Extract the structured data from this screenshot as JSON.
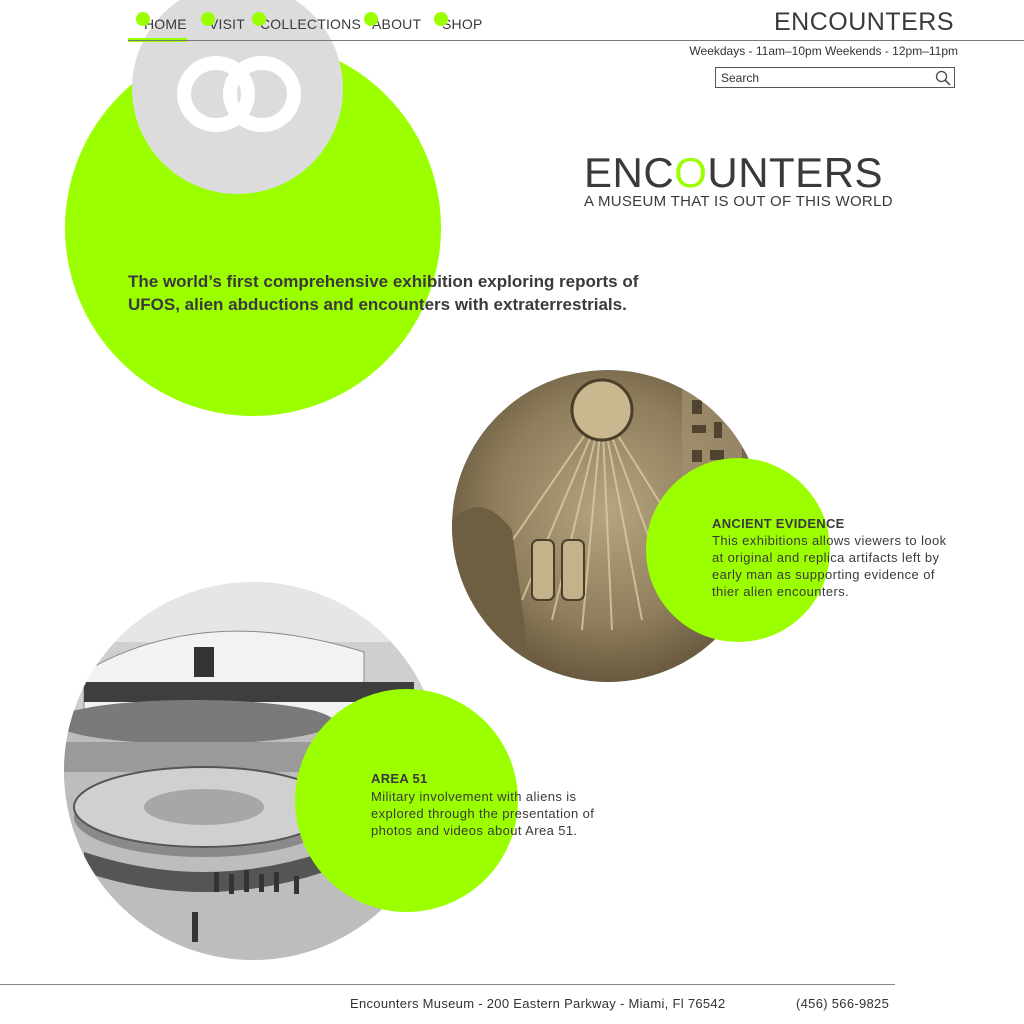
{
  "nav": {
    "items": [
      {
        "label": "HOME"
      },
      {
        "label": "VISIT"
      },
      {
        "label": "COLLECTIONS"
      },
      {
        "label": "ABOUT"
      },
      {
        "label": "SHOP"
      }
    ],
    "active": "HOME"
  },
  "header": {
    "brand": "ENCOUNTERS",
    "hours": "Weekdays - 11am–10pm Weekends - 12pm–11pm"
  },
  "search": {
    "placeholder": "Search",
    "icon": "search-icon"
  },
  "hero": {
    "title_part1": "ENC",
    "title_accent": "O",
    "title_part2": "UNTERS",
    "tagline": "A MUSEUM THAT IS OUT OF THIS WORLD",
    "intro": "The world’s first comprehensive exhibition exploring reports of UFOS, alien abductions and encounters with extraterrestrials."
  },
  "features": {
    "ancient": {
      "title": "ANCIENT EVIDENCE",
      "text": "This exhibitions allows viewers to look at original and replica artifacts left by early man as supporting evidence of thier alien encounters."
    },
    "area51": {
      "title": "AREA 51",
      "text": "Military involvement with aliens is explored through the presentation of photos and videos about Area 51."
    }
  },
  "footer": {
    "address": "Encounters Museum - 200 Eastern Parkway - Miami, Fl 76542",
    "phone": "(456) 566-9825"
  },
  "colors": {
    "accent": "#9cff00",
    "text": "#3a3a3a",
    "gray": "#dcdcdc"
  }
}
